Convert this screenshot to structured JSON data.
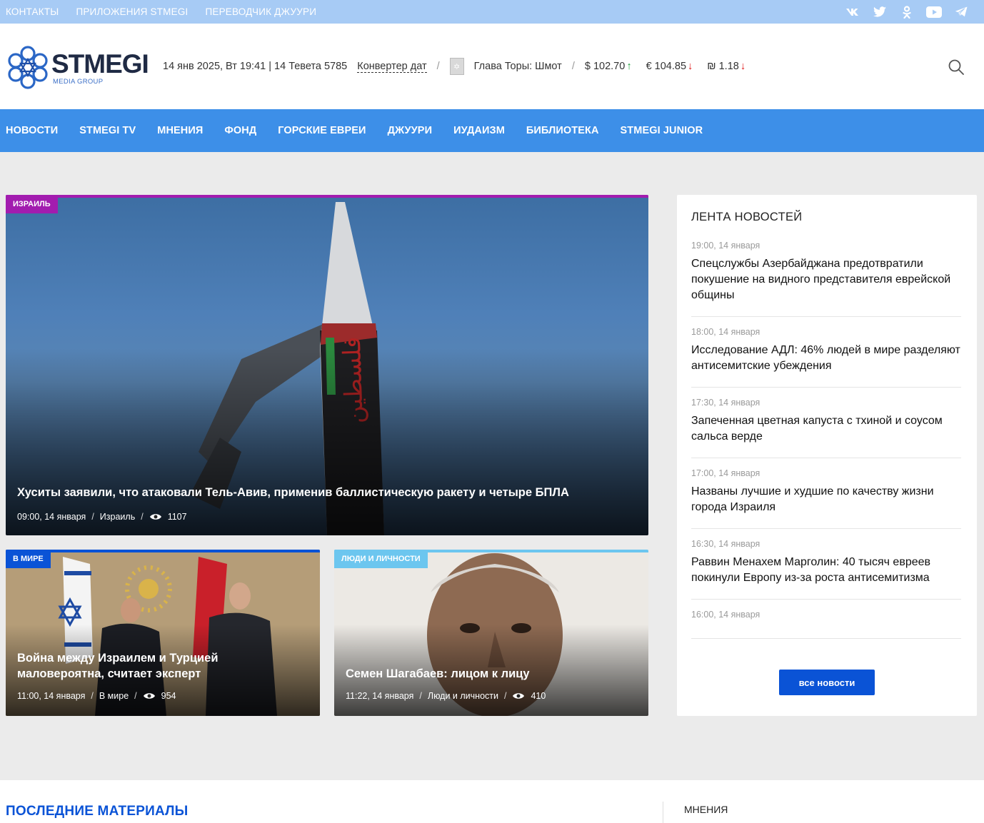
{
  "topbar": {
    "links": [
      "КОНТАКТЫ",
      "ПРИЛОЖЕНИЯ STMEGI",
      "ПЕРЕВОДЧИК ДЖУУРИ"
    ],
    "social": [
      "vk-icon",
      "twitter-icon",
      "odnoklassniki-icon",
      "youtube-icon",
      "telegram-icon"
    ]
  },
  "header": {
    "logo_word": "STMEGI",
    "logo_sub": "MEDIA GROUP",
    "date": "14 янв 2025, Вт 19:41 | 14 Тевета 5785",
    "converter": "Конвертер дат",
    "torah": "Глава Торы: Шмот",
    "usd": "$ 102.70",
    "eur": "€ 104.85",
    "ils": "₪ 1.18",
    "arrow_up": "↑",
    "arrow_down": "↓"
  },
  "nav": [
    "НОВОСТИ",
    "STMEGI TV",
    "МНЕНИЯ",
    "ФОНД",
    "ГОРСКИЕ ЕВРЕИ",
    "ДЖУУРИ",
    "ИУДАИЗМ",
    "БИБЛИОТЕКА",
    "STMEGI JUNIOR"
  ],
  "main_story": {
    "tag": "ИЗРАИЛЬ",
    "tag_color": "#a21caf",
    "title": "Хуситы заявили, что атаковали Тель-Авив, применив баллистическую ракету и четыре БПЛА",
    "time": "09:00, 14 января",
    "category": "Израиль",
    "views": "1107"
  },
  "story2": {
    "tag": "В МИРЕ",
    "tag_color": "#0a53d6",
    "title": "Война между Израилем и Турцией маловероятна, считает эксперт",
    "time": "11:00, 14 января",
    "category": "В мире",
    "views": "954"
  },
  "story3": {
    "tag": "ЛЮДИ И ЛИЧНОСТИ",
    "tag_color": "#6cc6ef",
    "title": "Семен Шагабаев: лицом к лицу",
    "time": "11:22, 14 января",
    "category": "Люди и личности",
    "views": "410"
  },
  "feed": {
    "title": "ЛЕНТА НОВОСТЕЙ",
    "items": [
      {
        "time": "19:00, 14 января",
        "text": "Спецслужбы Азербайджана предотвратили покушение на видного представителя еврейской общины"
      },
      {
        "time": "18:00, 14 января",
        "text": "Исследование АДЛ: 46% людей в мире разделяют антисемитские убеждения"
      },
      {
        "time": "17:30, 14 января",
        "text": "Запеченная цветная капуста с тхиной и соусом сальса верде"
      },
      {
        "time": "17:00, 14 января",
        "text": "Названы лучшие и худшие по качеству жизни города Израиля"
      },
      {
        "time": "16:30, 14 января",
        "text": "Раввин Менахем Марголин: 40 тысяч евреев покинули Европу из-за роста антисемитизма"
      },
      {
        "time": "16:00, 14 января",
        "text": ""
      }
    ],
    "button": "все новости"
  },
  "bottom": {
    "latest": "ПОСЛЕДНИЕ МАТЕРИАЛЫ",
    "opinions": "МНЕНИЯ"
  },
  "sep": "/",
  "colors": {
    "topbar": "#a7cbf5",
    "nav": "#3d8fe8",
    "accent": "#0a53d6"
  }
}
